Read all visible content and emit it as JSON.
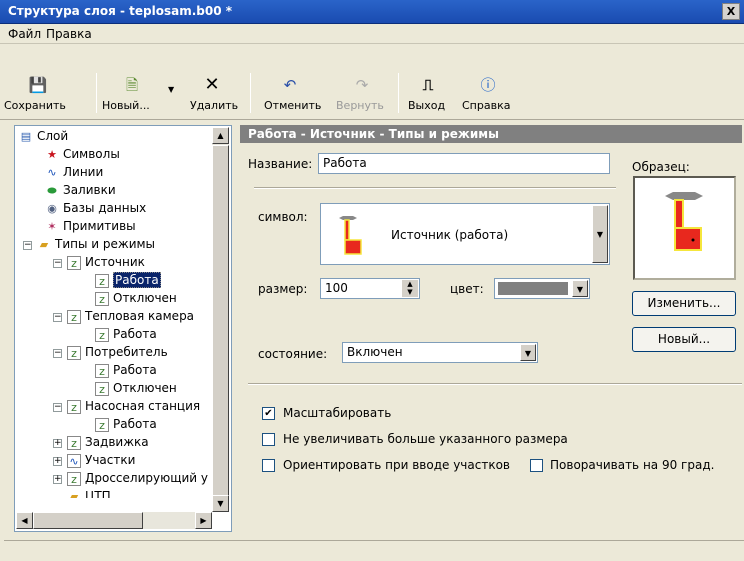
{
  "window": {
    "title": "Структура слоя - teplosam.b00 *",
    "close_glyph": "X"
  },
  "menu": [
    {
      "label": "Файл"
    },
    {
      "label": "Правка"
    }
  ],
  "toolbar": {
    "save": "Сохранить",
    "new": "Новый...",
    "delete": "Удалить",
    "undo": "Отменить",
    "redo": "Вернуть",
    "exit": "Выход",
    "help": "Справка"
  },
  "tree": {
    "items": [
      {
        "label": "Слой",
        "icon": "layer-icon"
      },
      {
        "label": "Символы",
        "icon": "star-icon"
      },
      {
        "label": "Линии",
        "icon": "line-icon"
      },
      {
        "label": "Заливки",
        "icon": "fill-icon"
      },
      {
        "label": "Базы данных",
        "icon": "database-icon"
      },
      {
        "label": "Примитивы",
        "icon": "primitives-icon"
      },
      {
        "label": "Типы и режимы",
        "icon": "folder-icon"
      },
      {
        "label": "Источник",
        "icon": "type-icon"
      },
      {
        "label": "Работа",
        "icon": "mode-icon"
      },
      {
        "label": "Отключен",
        "icon": "mode-icon"
      },
      {
        "label": "Тепловая камера",
        "icon": "type-icon"
      },
      {
        "label": "Работа",
        "icon": "mode-icon"
      },
      {
        "label": "Потребитель",
        "icon": "type-icon"
      },
      {
        "label": "Работа",
        "icon": "mode-icon"
      },
      {
        "label": "Отключен",
        "icon": "mode-icon"
      },
      {
        "label": "Насосная станция",
        "icon": "type-icon"
      },
      {
        "label": "Работа",
        "icon": "mode-icon"
      },
      {
        "label": "Задвижка",
        "icon": "type-icon"
      },
      {
        "label": "Участки",
        "icon": "line-icon"
      },
      {
        "label": "Дросселирующий у",
        "icon": "type-icon"
      },
      {
        "label": "ЦТП",
        "icon": "folder-icon"
      }
    ]
  },
  "panel": {
    "header": "Работа - Источник - Типы и режимы",
    "name_label": "Название:",
    "name_value": "Работа",
    "sample_label": "Образец:",
    "symbol_label": "символ:",
    "symbol_value": "Источник (работа)",
    "size_label": "размер:",
    "size_value": "100",
    "color_label": "цвет:",
    "state_label": "состояние:",
    "state_value": "Включен",
    "change_button": "Изменить...",
    "new_button": "Новый...",
    "checkboxes": [
      {
        "label": "Масштабировать",
        "checked": true
      },
      {
        "label": "Не увеличивать больше указанного размера",
        "checked": false
      },
      {
        "label": "Ориентировать при вводе участков",
        "checked": false
      },
      {
        "label": "Поворачивать на 90 град.",
        "checked": false
      }
    ]
  },
  "colors": {
    "symbol_red": "#e8281e",
    "symbol_yellow": "#f5e63c",
    "selection": "#0a246a"
  }
}
